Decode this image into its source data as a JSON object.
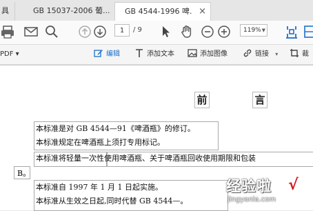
{
  "tabs": {
    "left_stub": "具",
    "items": [
      {
        "label": "GB 15037-2006 葡..."
      },
      {
        "label": "GB 4544-1996 啤...",
        "close": "×"
      }
    ]
  },
  "toolbar": {
    "page_current": "1",
    "page_total": "/ 9",
    "zoom": "119%"
  },
  "edit_toolbar": {
    "pdf_menu": "PDF ▾",
    "edit": "编辑",
    "add_text": "添加文本",
    "add_image": "添加图像",
    "link": "链接",
    "link_dd": "▾",
    "crop": "裁"
  },
  "document": {
    "heading_left": "前",
    "heading_right": "言",
    "lines": [
      "本标准是对 GB 4544—91《啤酒瓶》的修订。",
      "本标准规定在啤酒瓶上须打专用标记。",
      "本标准将轻量一次性使用啤酒瓶、关于啤酒瓶回收使用期限和包装",
      "本标准自 1997 年 1 月 1 日起实施。",
      "本标准从生效之日起,同时代替 GB 4544—。"
    ],
    "seal_b": "B。"
  },
  "watermark": {
    "text": "经验啦",
    "check": "√",
    "url": "jingyanla.com"
  },
  "colors": {
    "accent_blue": "#1a6fd0",
    "watermark_check": "#d8191e"
  }
}
